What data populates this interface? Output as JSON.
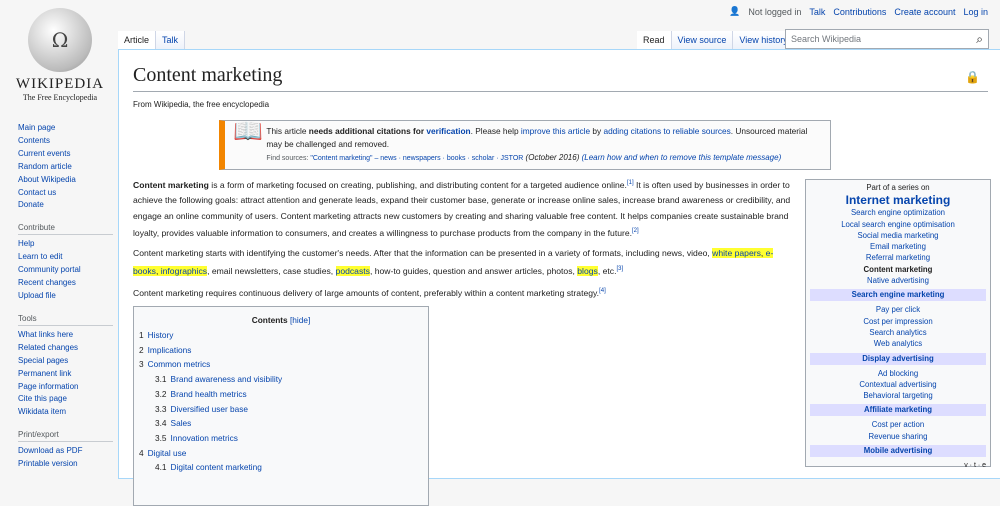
{
  "personal": {
    "status": "Not logged in",
    "talk": "Talk",
    "contributions": "Contributions",
    "create": "Create account",
    "login": "Log in"
  },
  "logo": {
    "wordmark": "Wikipedia",
    "tagline": "The Free Encyclopedia"
  },
  "nav": {
    "main": [
      "Main page",
      "Contents",
      "Current events",
      "Random article",
      "About Wikipedia",
      "Contact us",
      "Donate"
    ],
    "contribute_heading": "Contribute",
    "contribute": [
      "Help",
      "Learn to edit",
      "Community portal",
      "Recent changes",
      "Upload file"
    ],
    "tools_heading": "Tools",
    "tools": [
      "What links here",
      "Related changes",
      "Special pages",
      "Permanent link",
      "Page information",
      "Cite this page",
      "Wikidata item"
    ],
    "print_heading": "Print/export",
    "print": [
      "Download as PDF",
      "Printable version"
    ]
  },
  "tabs": {
    "article": "Article",
    "talk": "Talk",
    "read": "Read",
    "view_source": "View source",
    "view_history": "View history"
  },
  "search": {
    "placeholder": "Search Wikipedia"
  },
  "page": {
    "title": "Content marketing",
    "subtitle": "From Wikipedia, the free encyclopedia"
  },
  "ambox": {
    "t1": "This article ",
    "t2": "needs additional citations for ",
    "t3": "verification",
    "t4": ". Please help ",
    "t5": "improve this article",
    "t6": " by ",
    "t7": "adding citations to reliable sources",
    "t8": ". Unsourced material may be challenged and removed.",
    "fs_label": "Find sources: ",
    "fs_links": "\"Content marketing\" – news · newspapers · books · scholar · JSTOR",
    "date": " (October 2016) ",
    "learn": "(Learn how and when to remove this template message)"
  },
  "body": {
    "p1_bold": "Content marketing",
    "p1": " is a form of marketing focused on creating, publishing, and distributing content for a targeted audience online.",
    "r1": "[1]",
    "p1b": " It is often used by businesses in order to achieve the following goals: attract attention and generate leads, expand their customer base, generate or increase online sales, increase brand awareness or credibility, and engage an online community of users. Content marketing attracts new customers by creating and sharing valuable free content. It helps companies create sustainable brand loyalty, provides valuable information to consumers, and creates a willingness to purchase products from the company in the future.",
    "r2": "[2]",
    "p2a": "Content marketing starts with identifying the customer's needs. After that the information can be presented in a variety of formats, including news, video, ",
    "h1": "white papers",
    "c1": ", ",
    "h2": "e-books",
    "c2": ", ",
    "h3": "infographics",
    "p2b": ", email newsletters, case studies, ",
    "h4": "podcasts",
    "p2c": ", how-to guides, question and answer articles, photos, ",
    "h5": "blogs",
    "p2d": ", etc.",
    "r3": "[3]",
    "p3": "Content marketing requires continuous delivery of large amounts of content, preferably within a content marketing strategy.",
    "r4": "[4]"
  },
  "toc": {
    "title": "Contents",
    "hide": "[hide]",
    "items": [
      {
        "n": "1",
        "t": "History",
        "lvl": 1
      },
      {
        "n": "2",
        "t": "Implications",
        "lvl": 1
      },
      {
        "n": "3",
        "t": "Common metrics",
        "lvl": 1
      },
      {
        "n": "3.1",
        "t": "Brand awareness and visibility",
        "lvl": 2
      },
      {
        "n": "3.2",
        "t": "Brand health metrics",
        "lvl": 2
      },
      {
        "n": "3.3",
        "t": "Diversified user base",
        "lvl": 2
      },
      {
        "n": "3.4",
        "t": "Sales",
        "lvl": 2
      },
      {
        "n": "3.5",
        "t": "Innovation metrics",
        "lvl": 2
      },
      {
        "n": "4",
        "t": "Digital use",
        "lvl": 1
      },
      {
        "n": "4.1",
        "t": "Digital content marketing",
        "lvl": 2
      }
    ]
  },
  "infobox": {
    "pre": "Part of a series on",
    "title": "Internet marketing",
    "items": [
      "Search engine optimization",
      "Local search engine optimisation",
      "Social media marketing",
      "Email marketing",
      "Referral marketing",
      "Content marketing",
      "Native advertising"
    ],
    "groups": [
      {
        "h": "Search engine marketing",
        "items": [
          "Pay per click",
          "Cost per impression",
          "Search analytics",
          "Web analytics"
        ]
      },
      {
        "h": "Display advertising",
        "items": [
          "Ad blocking",
          "Contextual advertising",
          "Behavioral targeting"
        ]
      },
      {
        "h": "Affiliate marketing",
        "items": [
          "Cost per action",
          "Revenue sharing"
        ]
      },
      {
        "h": "Mobile advertising",
        "items": []
      }
    ],
    "vte": "v · t · e"
  }
}
